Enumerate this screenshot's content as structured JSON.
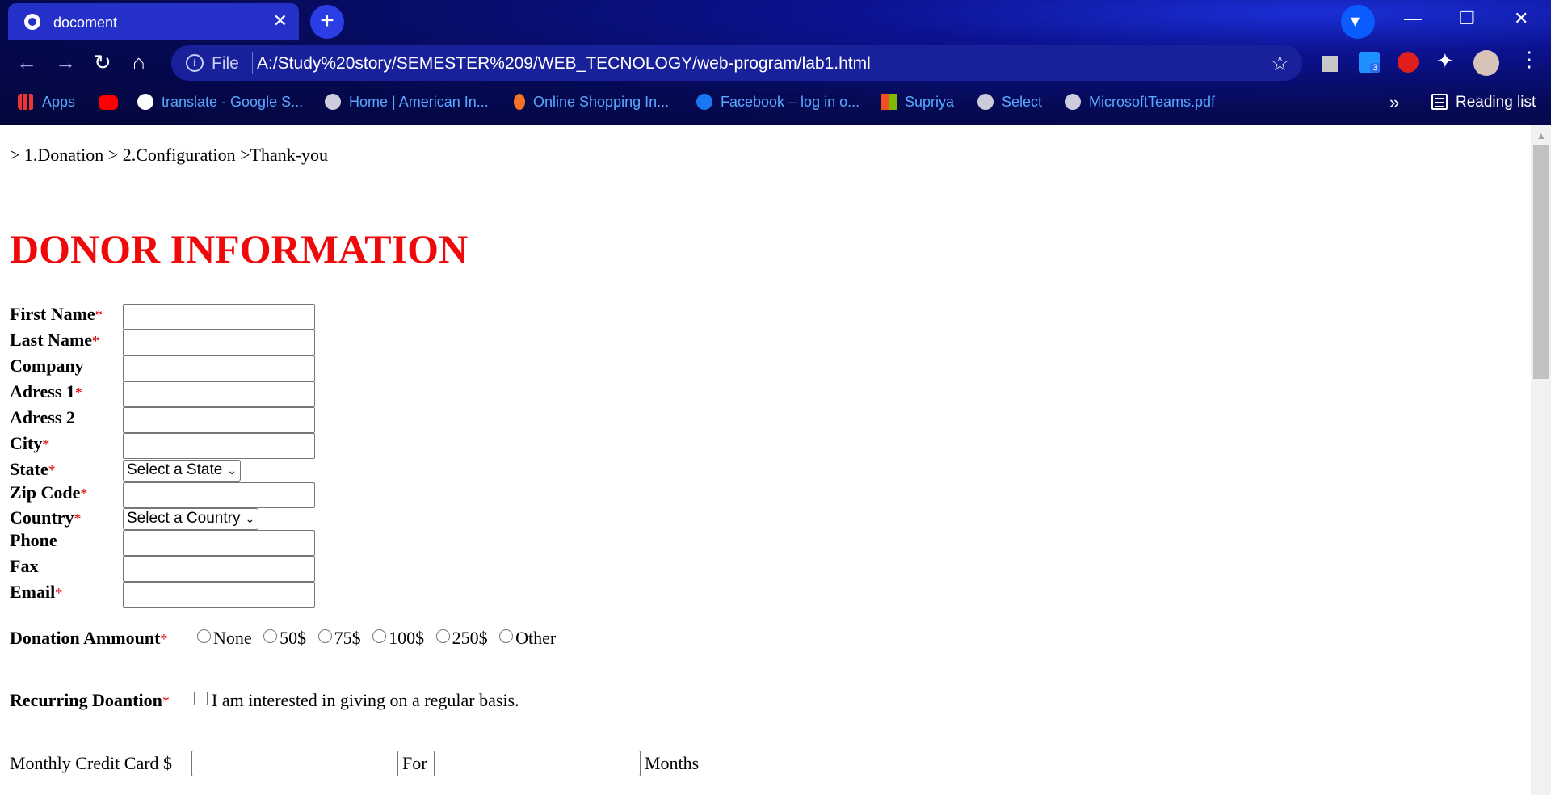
{
  "browser": {
    "tab_title": "docoment",
    "tab_close": "✕",
    "new_tab": "+",
    "address_prefix": "File",
    "url": "A:/Study%20story/SEMESTER%209/WEB_TECNOLOGY/web-program/lab1.html",
    "extension_badge": "3",
    "bookmarks": [
      {
        "label": "Apps",
        "icon": "apps-grid-icon",
        "color": "#e44"
      },
      {
        "label": "",
        "icon": "youtube-icon",
        "color": "#f00"
      },
      {
        "label": "translate - Google S...",
        "icon": "google-icon",
        "color": "#fff"
      },
      {
        "label": "Home | American In...",
        "icon": "shield-globe-icon",
        "color": "#ccd"
      },
      {
        "label": "Online Shopping In...",
        "icon": "daraz-icon",
        "color": "#f57224"
      },
      {
        "label": "Facebook – log in o...",
        "icon": "facebook-icon",
        "color": "#1877f2"
      },
      {
        "label": "Supriya",
        "icon": "microsoft-icon",
        "color": "#7fba00"
      },
      {
        "label": "Select",
        "icon": "shield-globe-icon",
        "color": "#ccd"
      },
      {
        "label": "MicrosoftTeams.pdf",
        "icon": "shield-globe-icon",
        "color": "#ccd"
      }
    ],
    "more_bookmarks": "»",
    "reading_list": "Reading list"
  },
  "page": {
    "breadcrumb": "> 1.Donation > 2.Configuration >Thank-you",
    "title": "DONOR INFORMATION",
    "required_mark": "*",
    "fields": {
      "first_name": "First Name",
      "last_name": "Last Name",
      "company": "Company",
      "address1": "Adress 1",
      "address2": "Adress 2",
      "city": "City",
      "state": "State",
      "zip": "Zip Code",
      "country": "Country",
      "phone": "Phone",
      "fax": "Fax",
      "email": "Email"
    },
    "state_select": "Select a State",
    "country_select": "Select a Country",
    "donation_label": "Donation Ammount",
    "donation_options": [
      "None",
      "50$",
      "75$",
      "100$",
      "250$",
      "Other"
    ],
    "recurring_label": "Recurring Doantion",
    "recurring_text": "I am interested in giving on a regular basis.",
    "monthly_label": "Monthly Credit Card $",
    "for_label": "For",
    "months_label": "Months"
  }
}
